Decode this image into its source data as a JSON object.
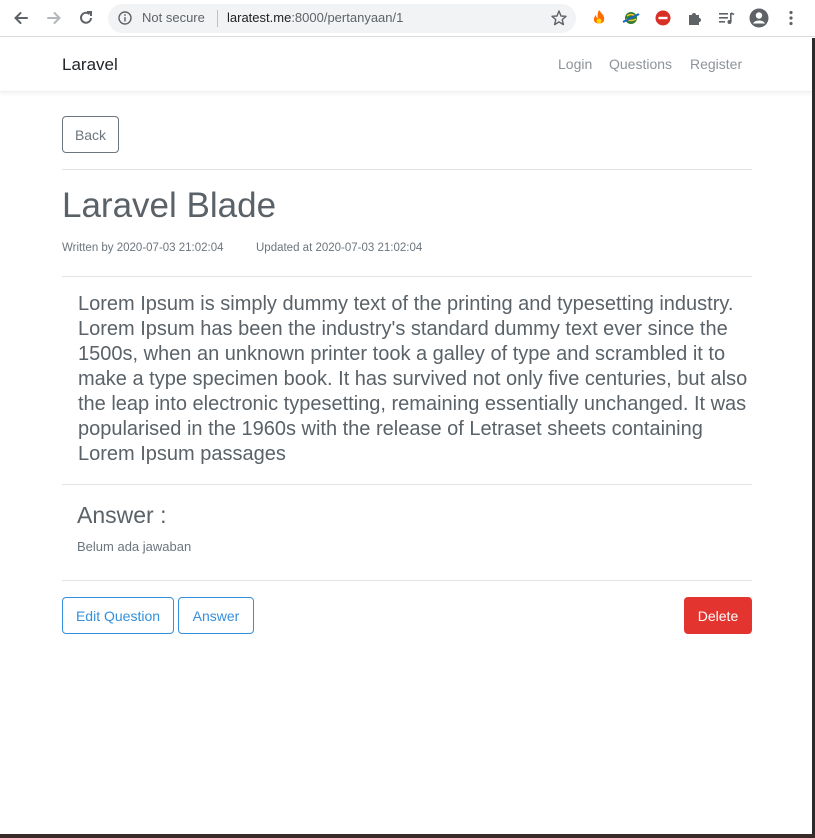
{
  "browser": {
    "security_label": "Not secure",
    "url_host": "laratest.me",
    "url_path": ":8000/pertanyaan/1",
    "icons": [
      "back-arrow-icon",
      "forward-arrow-icon",
      "reload-icon",
      "info-icon",
      "star-icon",
      "fire-extension-icon",
      "globe-extension-icon",
      "block-extension-icon",
      "puzzle-extension-icon",
      "media-queue-icon",
      "profile-icon",
      "kebab-menu-icon"
    ]
  },
  "navbar": {
    "brand": "Laravel",
    "links": [
      "Login",
      "Questions",
      "Register"
    ]
  },
  "page": {
    "back_label": "Back",
    "title": "Laravel Blade",
    "written_by": "Written by 2020-07-03 21:02:04",
    "updated_at": "Updated at 2020-07-03 21:02:04",
    "content": "Lorem Ipsum is simply dummy text of the printing and typesetting industry. Lorem Ipsum has been the industry's standard dummy text ever since the 1500s, when an unknown printer took a galley of type and scrambled it to make a type specimen book. It has survived not only five centuries, but also the leap into electronic typesetting, remaining essentially unchanged. It was popularised in the 1960s with the release of Letraset sheets containing Lorem Ipsum passages",
    "answer_heading": "Answer :",
    "answer_empty": "Belum ada jawaban",
    "edit_label": "Edit Question",
    "answer_label": "Answer",
    "delete_label": "Delete"
  },
  "colors": {
    "primary": "#3490dc",
    "danger": "#e3342f",
    "secondary": "#6c757d"
  }
}
